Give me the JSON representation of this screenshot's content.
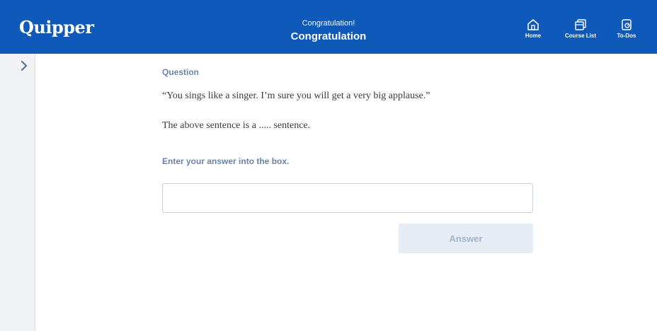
{
  "header": {
    "logo": "Quipper",
    "subtitle": "Congratulation!",
    "title": "Congratulation",
    "nav": [
      {
        "label": "Home",
        "icon": "home-icon"
      },
      {
        "label": "Course List",
        "icon": "course-list-icon"
      },
      {
        "label": "To-Dos",
        "icon": "todos-icon"
      }
    ],
    "color": "#0e59b9"
  },
  "sidebar": {
    "toggle_icon": "chevron-right-icon"
  },
  "question": {
    "label": "Question",
    "text_1": "“You sings like a singer. I’m sure you will get a very big applause.”",
    "text_2": "The above sentence is a ..... sentence."
  },
  "answer": {
    "instruction": "Enter your answer into the box.",
    "input_value": "",
    "button_label": "Answer"
  }
}
